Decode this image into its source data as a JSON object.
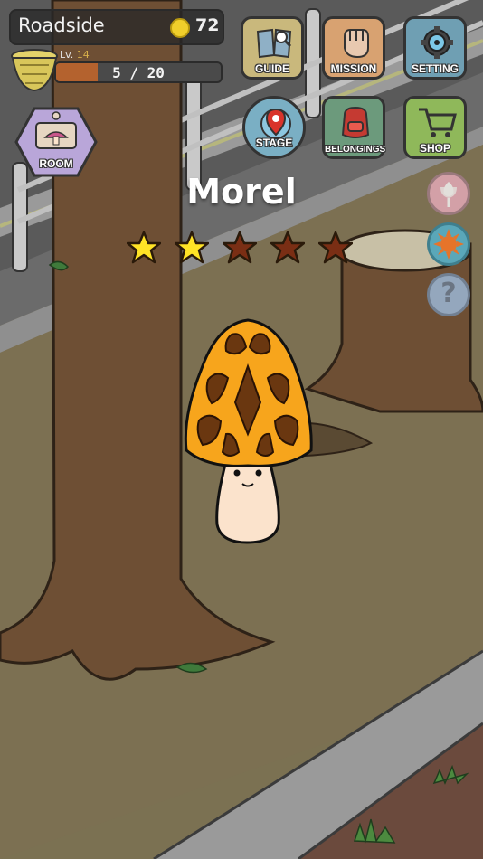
{
  "hud": {
    "stage_name": "Roadside",
    "coins": "72",
    "level_prefix": "Lv. ",
    "level": "14",
    "xp_text": "5 / 20",
    "xp_progress": 0.25
  },
  "buttons": {
    "room": "ROOM",
    "guide": "GUIDE",
    "mission": "MISSION",
    "setting": "SETTING",
    "stage": "STAGE",
    "belongings": "BELONGINGS",
    "shop": "SHOP"
  },
  "side_icons": [
    "flower-icon",
    "sun-icon",
    "question-icon"
  ],
  "mushroom": {
    "name": "Morel",
    "rarity_max": 5,
    "rarity_filled": 2
  },
  "colors": {
    "star_filled": "#ffe326",
    "star_empty": "#7a2e14",
    "morel_cap": "#f7a51c",
    "morel_pit": "#6a3710",
    "guide_btn": "#c9b87c",
    "mission_btn": "#d8a271",
    "setting_btn": "#6f9fb3",
    "belongings_btn": "#6c9a7c",
    "shop_btn": "#8fb85a",
    "stage_btn": "#7aafc4"
  }
}
